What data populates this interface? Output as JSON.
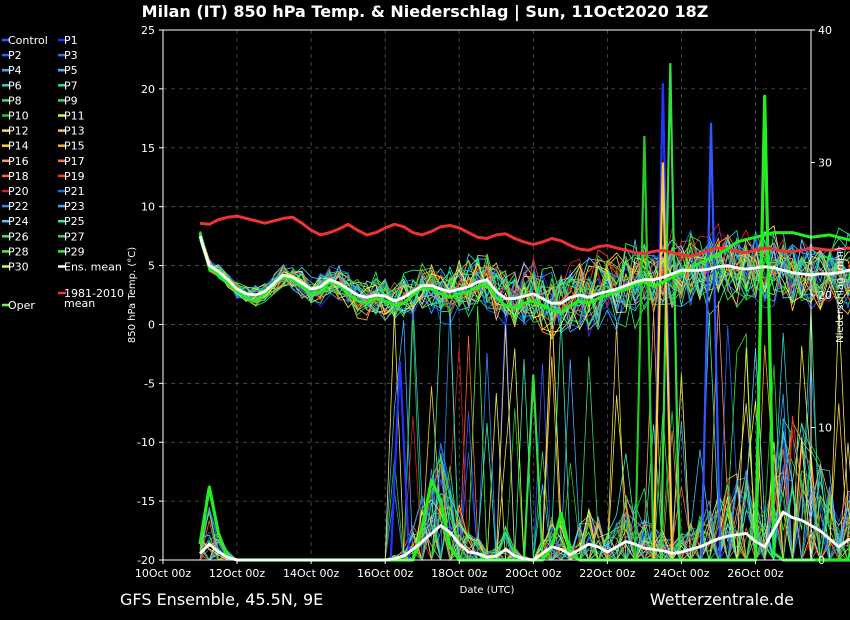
{
  "chart_data": {
    "type": "line",
    "title": "Milan  (IT)  850 hPa Temp. & Niederschlag | Sun, 11Oct2020 18Z",
    "xlabel": "Date (UTC)",
    "ylabel_left": "850 hPa Temp. (°C)",
    "ylabel_right": "Niederschlag (mm)",
    "x_tick_labels": [
      "10Oct 00z",
      "12Oct 00z",
      "14Oct 00z",
      "16Oct 00z",
      "18Oct 00z",
      "20Oct 00z",
      "22Oct 00z",
      "24Oct 00z",
      "26Oct 00z"
    ],
    "x_tick_day": [
      0,
      2,
      4,
      6,
      8,
      10,
      12,
      14,
      16
    ],
    "x_range_days": [
      0,
      17.5
    ],
    "y_left_ticks": [
      "25",
      "20",
      "15",
      "10",
      "5",
      "0",
      "-5",
      "-10",
      "-15",
      "-20"
    ],
    "y_left_range": [
      -20,
      25
    ],
    "y_right_ticks": [
      "40",
      "30",
      "20",
      "10",
      "0"
    ],
    "y_right_range": [
      0,
      40
    ],
    "grid": true,
    "footer_left": "GFS Ensemble, 45.5N, 9E",
    "footer_right": "Wetterzentrale.de",
    "legend": [
      {
        "label": "Control",
        "color": "#3355ff"
      },
      {
        "label": "P1",
        "color": "#2233ff"
      },
      {
        "label": "P2",
        "color": "#2266ff"
      },
      {
        "label": "P3",
        "color": "#2277ff"
      },
      {
        "label": "P4",
        "color": "#44aaff"
      },
      {
        "label": "P5",
        "color": "#33bbff"
      },
      {
        "label": "P6",
        "color": "#33cccc"
      },
      {
        "label": "P7",
        "color": "#22ddaa"
      },
      {
        "label": "P8",
        "color": "#33dd77"
      },
      {
        "label": "P9",
        "color": "#33dd44"
      },
      {
        "label": "P10",
        "color": "#22cc22"
      },
      {
        "label": "P11",
        "color": "#eeee33"
      },
      {
        "label": "P12",
        "color": "#eedd66"
      },
      {
        "label": "P13",
        "color": "#eecc44"
      },
      {
        "label": "P14",
        "color": "#ffcc33"
      },
      {
        "label": "P15",
        "color": "#ffaa22"
      },
      {
        "label": "P16",
        "color": "#ee9966"
      },
      {
        "label": "P17",
        "color": "#ee7744"
      },
      {
        "label": "P18",
        "color": "#ff6633"
      },
      {
        "label": "P19",
        "color": "#ee4422"
      },
      {
        "label": "P20",
        "color": "#cc2222"
      },
      {
        "label": "P21",
        "color": "#2266ee"
      },
      {
        "label": "P22",
        "color": "#3388ff"
      },
      {
        "label": "P23",
        "color": "#33aaff"
      },
      {
        "label": "P24",
        "color": "#55ccff"
      },
      {
        "label": "P25",
        "color": "#33eeaa"
      },
      {
        "label": "P26",
        "color": "#33ee66"
      },
      {
        "label": "P27",
        "color": "#22dd55"
      },
      {
        "label": "P28",
        "color": "#55ee33"
      },
      {
        "label": "P29",
        "color": "#33ee33"
      },
      {
        "label": "P30",
        "color": "#eeee44"
      },
      {
        "label": "Ens. mean",
        "color": "#ffffff"
      },
      {
        "label": "Oper",
        "color": "#66ff33"
      },
      {
        "label": "1981-2010 mean",
        "color": "#ff3333"
      }
    ],
    "temp_series": {
      "start_day": 1.0,
      "step_days": 0.25,
      "ens_mean": [
        7.5,
        5.0,
        4.5,
        3.8,
        3.0,
        2.6,
        2.5,
        2.8,
        3.5,
        4.2,
        4.0,
        3.5,
        3.0,
        3.2,
        3.8,
        3.5,
        3.0,
        2.5,
        2.3,
        2.5,
        2.4,
        2.0,
        2.3,
        2.8,
        3.3,
        3.3,
        3.0,
        2.8,
        3.0,
        3.2,
        3.6,
        3.8,
        2.8,
        2.2,
        2.2,
        2.4,
        2.6,
        2.2,
        1.8,
        1.8,
        2.3,
        2.5,
        2.3,
        2.6,
        2.8,
        3.0,
        3.3,
        3.6,
        3.8,
        3.8,
        4.0,
        4.3,
        4.6,
        4.6,
        4.6,
        4.7,
        4.9,
        5.0,
        4.8,
        4.7,
        4.8,
        4.9,
        4.8,
        4.6,
        4.4,
        4.3,
        4.2,
        4.3,
        4.3,
        4.4,
        4.6,
        4.7,
        4.8,
        4.6,
        4.5,
        4.4,
        4.5,
        4.8,
        5.0,
        4.9,
        4.7,
        4.6,
        4.8,
        4.8
      ],
      "oper": [
        7.8,
        4.8,
        4.2,
        3.5,
        2.8,
        2.2,
        2.0,
        2.6,
        3.5,
        4.0,
        3.8,
        3.2,
        2.6,
        2.8,
        3.6,
        3.4,
        2.6,
        2.0,
        1.8,
        2.2,
        2.0,
        1.6,
        1.8,
        2.5,
        3.1,
        3.0,
        2.6,
        2.3,
        2.6,
        2.8,
        3.2,
        3.4,
        2.3,
        1.6,
        1.4,
        1.8,
        2.0,
        1.6,
        1.2,
        1.0,
        1.6,
        2.0,
        1.8,
        2.2,
        2.5,
        2.8,
        3.0,
        3.4,
        3.6,
        3.2,
        3.6,
        4.0,
        4.4,
        4.8,
        5.2,
        5.6,
        6.0,
        6.4,
        7.0,
        7.2,
        7.4,
        7.6,
        7.8,
        7.8,
        7.8,
        7.6,
        7.4,
        7.5,
        7.6,
        7.4,
        7.2,
        7.0,
        7.0,
        6.9,
        6.6,
        6.3,
        6.5,
        6.6,
        6.8,
        6.9,
        7.2,
        7.4,
        7.6,
        7.4
      ],
      "clim_mean": [
        8.6,
        8.5,
        8.9,
        9.1,
        9.2,
        9.0,
        8.8,
        8.6,
        8.8,
        9.0,
        9.1,
        8.6,
        8.0,
        7.6,
        7.8,
        8.1,
        8.5,
        8.0,
        7.6,
        7.8,
        8.2,
        8.5,
        8.3,
        7.8,
        7.6,
        7.9,
        8.3,
        8.4,
        8.2,
        7.8,
        7.4,
        7.3,
        7.6,
        7.7,
        7.3,
        7.0,
        6.8,
        7.0,
        7.3,
        7.1,
        6.7,
        6.4,
        6.3,
        6.6,
        6.7,
        6.5,
        6.3,
        6.1,
        6.0,
        6.2,
        6.3,
        6.1,
        5.9,
        5.8,
        6.0,
        6.3,
        6.5,
        6.4,
        6.2,
        6.1,
        6.3,
        6.5,
        6.4,
        6.2,
        6.2,
        6.3,
        6.5,
        6.4,
        6.3,
        6.4,
        6.5,
        6.3,
        6.2,
        6.3,
        6.4,
        6.1,
        6.0,
        6.2,
        6.3,
        6.2,
        6.5,
        6.7,
        6.6,
        6.5
      ],
      "members_spread_note": ""
    },
    "precip_series": {
      "start_day": 1.0,
      "step_days": 0.25,
      "ens_mean": [
        0.5,
        1.2,
        0.6,
        0.2,
        0,
        0,
        0,
        0,
        0,
        0,
        0,
        0,
        0,
        0,
        0,
        0,
        0,
        0,
        0,
        0,
        0,
        0.1,
        0.3,
        0.8,
        1.4,
        2.0,
        2.6,
        2.1,
        1.2,
        0.6,
        0.5,
        0.2,
        0.3,
        0.8,
        0.3,
        0.1,
        0,
        0.5,
        1.0,
        0.8,
        0.4,
        0.8,
        1.2,
        1.0,
        0.6,
        1.0,
        1.4,
        1.2,
        0.9,
        0.8,
        0.7,
        0.5,
        0.6,
        0.8,
        1.0,
        1.3,
        1.6,
        1.8,
        1.9,
        2.0,
        1.4,
        1.0,
        2.3,
        3.6,
        3.2,
        3.0,
        2.6,
        2.2,
        1.6,
        1.0,
        1.5,
        1.8,
        1.6,
        1.4,
        1.3,
        1.5,
        1.4,
        1.2,
        1.5,
        1.2,
        1.3,
        1.6,
        1.2,
        0.5,
        0.4,
        0.8,
        0.3,
        1.0
      ],
      "oper": [
        1.2,
        5.5,
        2.0,
        0.2,
        0,
        0,
        0,
        0,
        0,
        0,
        0,
        0,
        0,
        0,
        0,
        0,
        0,
        0,
        0,
        0,
        0,
        0,
        0,
        0,
        2.5,
        6.0,
        4.5,
        1.0,
        0,
        0,
        0,
        0,
        0,
        0,
        0,
        0,
        0,
        0,
        1.0,
        3.5,
        0.5,
        0,
        0,
        0,
        0,
        0,
        0,
        0,
        0,
        0,
        0,
        0,
        0,
        0,
        0,
        0,
        0,
        0,
        0,
        0,
        0,
        35.0,
        0.5,
        0,
        0,
        0,
        0,
        0,
        0,
        0,
        0,
        0,
        0,
        9.5,
        0,
        0,
        0,
        4.0,
        0,
        0,
        12.5,
        0,
        0,
        0,
        0,
        0,
        0,
        0
      ]
    }
  }
}
